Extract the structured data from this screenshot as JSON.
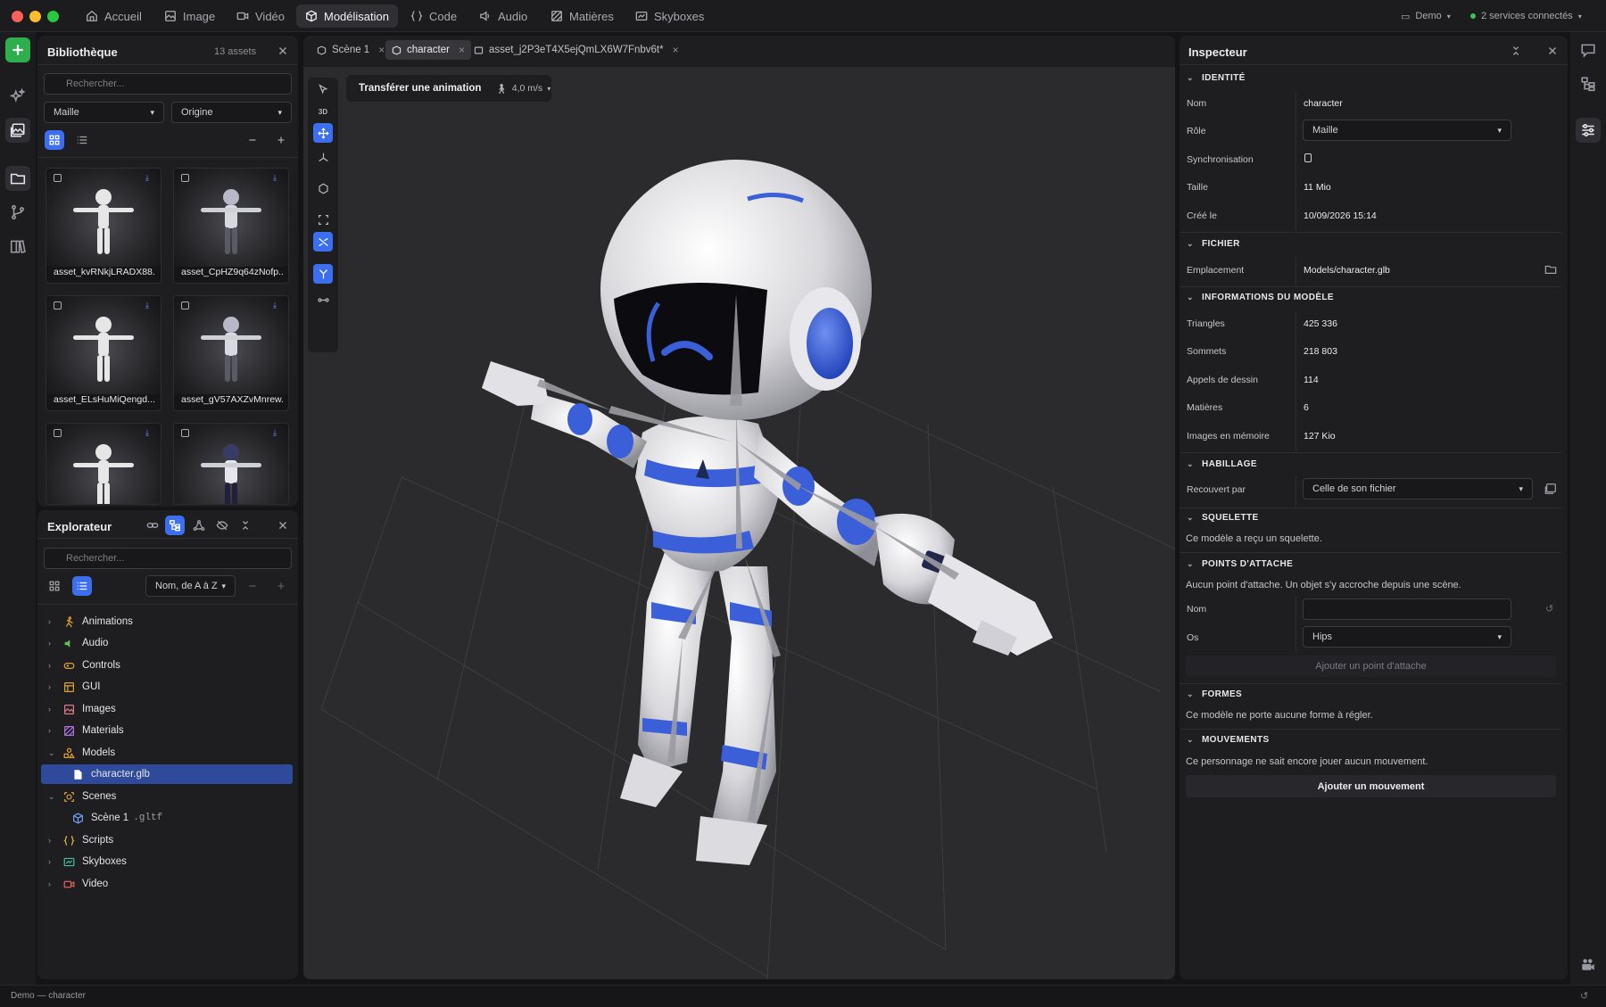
{
  "titlebar": {
    "tabs": [
      {
        "label": "Accueil",
        "icon": "home-icon"
      },
      {
        "label": "Image",
        "icon": "image-icon"
      },
      {
        "label": "Vidéo",
        "icon": "video-icon"
      },
      {
        "label": "Modélisation",
        "icon": "cube-icon"
      },
      {
        "label": "Code",
        "icon": "code-braces-icon"
      },
      {
        "label": "Audio",
        "icon": "speaker-icon"
      },
      {
        "label": "Matières",
        "icon": "texture-icon"
      },
      {
        "label": "Skyboxes",
        "icon": "skybox-icon"
      }
    ],
    "active_tab": "Modélisation",
    "project": "Demo",
    "services": "2 services connectés"
  },
  "library": {
    "title": "Bibliothèque",
    "count": "13 assets",
    "search_placeholder": "Rechercher...",
    "filter_type": "Maille",
    "filter_origin": "Origine",
    "assets": [
      {
        "name": "asset_kvRNkjLRADX88..."
      },
      {
        "name": "asset_CpHZ9q64zNofp..."
      },
      {
        "name": "asset_ELsHuMiQengd..."
      },
      {
        "name": "asset_gV57AXZvMnrew..."
      },
      {
        "name": ""
      },
      {
        "name": ""
      }
    ]
  },
  "explorer": {
    "title": "Explorateur",
    "search_placeholder": "Rechercher...",
    "sort": "Nom, de A à Z",
    "items": [
      {
        "label": "Animations",
        "icon": "running-figure-icon",
        "color": "#e0a030"
      },
      {
        "label": "Audio",
        "icon": "speaker-icon",
        "color": "#5fc15a"
      },
      {
        "label": "Controls",
        "icon": "gamepad-icon",
        "color": "#e0a030"
      },
      {
        "label": "GUI",
        "icon": "layout-icon",
        "color": "#e0a030"
      },
      {
        "label": "Images",
        "icon": "image-icon",
        "color": "#e07a8a"
      },
      {
        "label": "Materials",
        "icon": "texture-icon",
        "color": "#b070e0"
      },
      {
        "label": "Models",
        "icon": "shapes-icon",
        "color": "#e0a030"
      },
      {
        "label": "character.glb",
        "icon": "file-icon",
        "color": "#ffffff"
      },
      {
        "label": "Scenes",
        "icon": "scene-icon",
        "color": "#e0a030"
      },
      {
        "label": "Scène 1",
        "ext": ".gltf",
        "icon": "cube-icon",
        "color": "#6f9ff5"
      },
      {
        "label": "Scripts",
        "icon": "code-braces-icon",
        "color": "#e0c030"
      },
      {
        "label": "Skyboxes",
        "icon": "skybox-icon",
        "color": "#40c0a0"
      },
      {
        "label": "Video",
        "icon": "video-icon",
        "color": "#e06060"
      }
    ]
  },
  "viewport": {
    "tabs": [
      {
        "label": "Scène 1"
      },
      {
        "label": "character"
      },
      {
        "label": "asset_j2P3eT4X5ejQmLX6W7Fnbv6t*"
      }
    ],
    "transfer_button": "Transférer une animation",
    "speed": "4,0 m/s",
    "tool_3d": "3D"
  },
  "inspector": {
    "title": "Inspecteur",
    "sections": {
      "identity": "IDENTITÉ",
      "file": "FICHIER",
      "model_info": "INFORMATIONS DU MODÈLE",
      "skinning": "HABILLAGE",
      "skeleton": "SQUELETTE",
      "attach": "POINTS D'ATTACHE",
      "shapes": "FORMES",
      "moves": "MOUVEMENTS"
    },
    "identity": {
      "name_label": "Nom",
      "name_value": "character",
      "role_label": "Rôle",
      "role_value": "Maille",
      "sync_label": "Synchronisation",
      "size_label": "Taille",
      "size_value": "11 Mio",
      "created_label": "Créé le",
      "created_value": "10/09/2026 15:14"
    },
    "file": {
      "location_label": "Emplacement",
      "location_value": "Models/character.glb"
    },
    "model_info": {
      "triangles_label": "Triangles",
      "triangles_value": "425 336",
      "vertices_label": "Sommets",
      "vertices_value": "218 803",
      "drawcalls_label": "Appels de dessin",
      "drawcalls_value": "114",
      "materials_label": "Matières",
      "materials_value": "6",
      "images_label": "Images en mémoire",
      "images_value": "127 Kio"
    },
    "skinning": {
      "covered_label": "Recouvert par",
      "covered_value": "Celle de son fichier"
    },
    "skeleton_note": "Ce modèle a reçu un squelette.",
    "attach": {
      "note": "Aucun point d'attache. Un objet s'y accroche depuis une scène.",
      "name_label": "Nom",
      "name_value": "",
      "bone_label": "Os",
      "bone_value": "Hips",
      "add_button": "Ajouter un point d'attache"
    },
    "shapes_note": "Ce modèle ne porte aucune forme à régler.",
    "moves_note": "Ce personnage ne sait encore jouer aucun mouvement.",
    "add_move_button": "Ajouter un mouvement"
  },
  "statusbar": {
    "text": "Demo — character"
  },
  "colors": {
    "accent": "#3b6ff0",
    "add_button": "#2fae4e",
    "panel": "#1e1e21",
    "viewport": "#2b2b2e"
  }
}
